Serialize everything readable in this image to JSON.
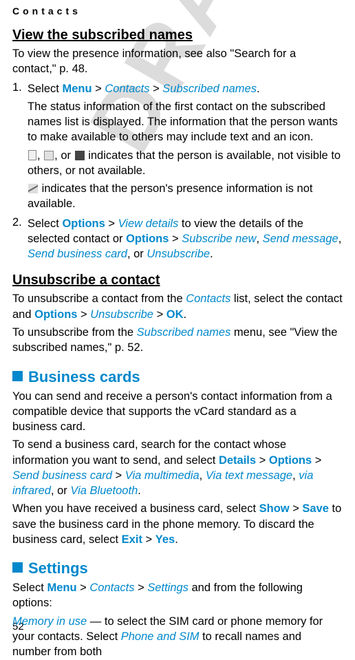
{
  "header": "Contacts",
  "h1": "View the subscribed names",
  "p1a": "To view the presence information, see also \"Search for a contact,\" p. 48.",
  "s1num": "1.",
  "s1a_pre": "Select ",
  "menu": "Menu",
  "gt": " > ",
  "contacts": "Contacts",
  "subnames": "Subscribed names",
  "dot": ".",
  "s1b": "The status information of the first contact on the subscribed names list is displayed. The information that the person wants to make available to others may include text and an icon.",
  "s1c_mid": ", or ",
  "s1c_post": " indicates that the person is available, not visible to others, or not available.",
  "s1d": " indicates that the person's presence information is not available.",
  "s2num": "2.",
  "s2a_pre": "Select ",
  "options": "Options",
  "viewdetails": "View details",
  "s2a_mid1": " to view the details of the selected contact or ",
  "subnew": "Subscribe new",
  "comma": ", ",
  "sendmsg": "Send message",
  "sendbiz": "Send business card",
  "or": ", or ",
  "unsub": "Unsubscribe",
  "h2": "Unsubscribe a contact",
  "p2a_pre": "To unsubscribe a contact from the ",
  "p2a_mid": " list, select the contact and ",
  "ok": "OK",
  "p2b_pre": "To unsubscribe from the ",
  "p2b_post": " menu, see \"View the subscribed names,\" p. 52.",
  "h3": "Business cards",
  "p3a": "You can send and receive a person's contact information from a compatible device that supports the vCard standard as a business card.",
  "p3b_pre": "To send a business card, search for the contact whose information you want to send, and select ",
  "details": "Details",
  "sendbizcard": "Send business card",
  "viamm": "Via multimedia",
  "viatxt": "Via text message",
  "viair": "via infrared",
  "viabt": "Via Bluetooth",
  "p3c_pre": "When you have received a business card, select ",
  "show": "Show",
  "save": "Save",
  "p3c_mid": " to save the business card in the phone memory. To discard the business card, select ",
  "exit": "Exit",
  "yes": "Yes",
  "h4": "Settings",
  "p4a_pre": "Select ",
  "settings": "Settings",
  "p4a_post": " and from the following options:",
  "meminuse": "Memory in use",
  "p4b_mid": " — to select the SIM card or phone memory for your contacts. Select ",
  "phonesim": "Phone and SIM",
  "p4b_post": " to recall names and number from both",
  "pagenum": "52"
}
